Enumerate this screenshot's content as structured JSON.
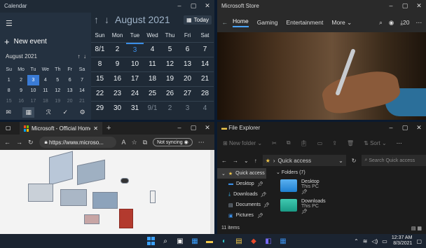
{
  "calendar": {
    "title": "Calendar",
    "new_event": "New event",
    "mini_month": "August 2021",
    "mini_dow": [
      "Su",
      "Mo",
      "Tu",
      "We",
      "Th",
      "Fr",
      "Sa"
    ],
    "mini_weeks": [
      [
        "1",
        "2",
        "3",
        "4",
        "5",
        "6",
        "7"
      ],
      [
        "8",
        "9",
        "10",
        "11",
        "12",
        "13",
        "14"
      ],
      [
        "15",
        "16",
        "17",
        "18",
        "19",
        "20",
        "21"
      ]
    ],
    "month": "August 2021",
    "today_label": "Today",
    "dow": [
      "Sun",
      "Mon",
      "Tue",
      "Wed",
      "Thu",
      "Fri",
      "Sat"
    ],
    "weeks": [
      [
        "8/1",
        "2",
        "3",
        "4",
        "5",
        "6",
        "7"
      ],
      [
        "8",
        "9",
        "10",
        "11",
        "12",
        "13",
        "14"
      ],
      [
        "15",
        "16",
        "17",
        "18",
        "19",
        "20",
        "21"
      ],
      [
        "22",
        "23",
        "24",
        "25",
        "26",
        "27",
        "28"
      ],
      [
        "29",
        "30",
        "31",
        "9/1",
        "2",
        "3",
        "4"
      ]
    ]
  },
  "store": {
    "title": "Microsoft Store",
    "tabs": [
      "Home",
      "Gaming",
      "Entertainment",
      "More"
    ],
    "downloads": "20"
  },
  "edge": {
    "tab_title": "Microsoft - Official Home Page",
    "address": "https://www.microso...",
    "sync": "Not syncing"
  },
  "explorer": {
    "title": "File Explorer",
    "new_folder": "New folder",
    "sort": "Sort",
    "crumb": "Quick access",
    "search_placeholder": "Search Quick access",
    "nav": [
      "Quick access",
      "Desktop",
      "Downloads",
      "Documents",
      "Pictures"
    ],
    "group": "Folders (7)",
    "folders": [
      {
        "name": "Desktop",
        "sub": "This PC"
      },
      {
        "name": "Downloads",
        "sub": "This PC"
      }
    ],
    "status": "11 items"
  },
  "taskbar": {
    "time": "12:37 AM",
    "date": "8/3/2021"
  }
}
